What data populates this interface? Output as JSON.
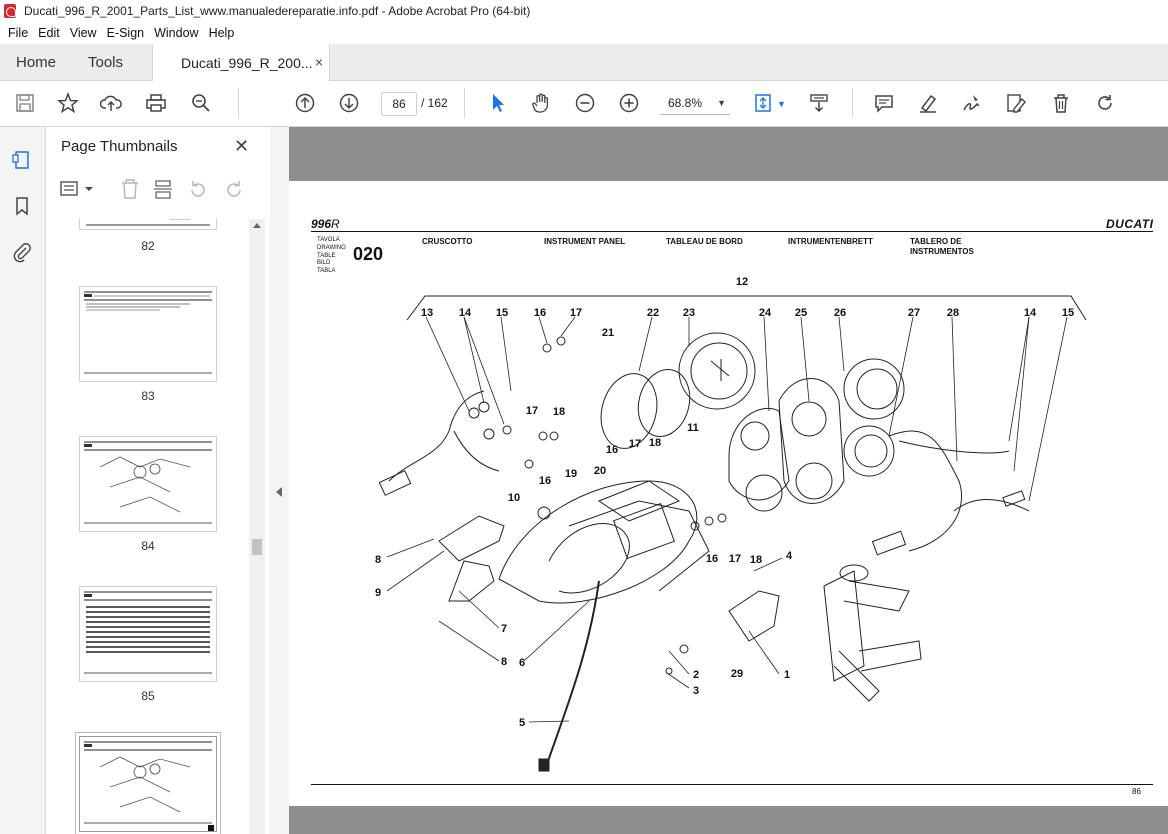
{
  "window": {
    "title": "Ducati_996_R_2001_Parts_List_www.manualedereparatie.info.pdf - Adobe Acrobat Pro (64-bit)"
  },
  "menu": [
    "File",
    "Edit",
    "View",
    "E-Sign",
    "Window",
    "Help"
  ],
  "tabs": {
    "home": "Home",
    "tools": "Tools",
    "document": "Ducati_996_R_200...",
    "close": "×"
  },
  "toolbar": {
    "current_page": "86",
    "total_pages": "/  162",
    "zoom": "68.8%"
  },
  "panel": {
    "title": "Page Thumbnails",
    "close": "✕",
    "thumbnails": [
      {
        "label": "82"
      },
      {
        "label": "83"
      },
      {
        "label": "84"
      },
      {
        "label": "85"
      },
      {
        "label": ""
      }
    ]
  },
  "page": {
    "model": "996",
    "model_suffix": "R",
    "brand": "DUCATI",
    "table_words": [
      "TAVOLA",
      "DRAWING",
      "TABLE",
      "BILD",
      "TABLA"
    ],
    "table_number": "020",
    "titles": [
      "CRUSCOTTO",
      "INSTRUMENT PANEL",
      "TABLEAU DE BORD",
      "INTRUMENTENBRETT",
      "TABLERO DE INSTRUMENTOS"
    ],
    "page_number": "86",
    "callouts": [
      "12",
      "13",
      "14",
      "15",
      "16",
      "17",
      "21",
      "22",
      "23",
      "24",
      "25",
      "26",
      "27",
      "28",
      "14",
      "15",
      "17",
      "18",
      "11",
      "16",
      "17",
      "18",
      "10",
      "16",
      "20",
      "19",
      "8",
      "9",
      "7",
      "8",
      "6",
      "16",
      "17",
      "18",
      "4",
      "2",
      "3",
      "29",
      "1",
      "5"
    ]
  },
  "colors": {
    "acrobat_red": "#d7282f",
    "chrome_gray": "#ececec",
    "viewer_bg": "#8e8e8e",
    "accent_blue": "#1a73e8"
  },
  "icons": [
    "save-icon",
    "bookmark-star-icon",
    "upload-icon",
    "print-icon",
    "zoom-search-icon",
    "page-up-icon",
    "page-down-icon",
    "select-cursor-icon",
    "hand-icon",
    "zoom-out-icon",
    "zoom-in-icon",
    "fit-page-icon",
    "scroll-mode-icon",
    "comment-icon",
    "highlight-icon",
    "sign-icon",
    "edit-icon",
    "delete-icon",
    "rotate-icon"
  ]
}
